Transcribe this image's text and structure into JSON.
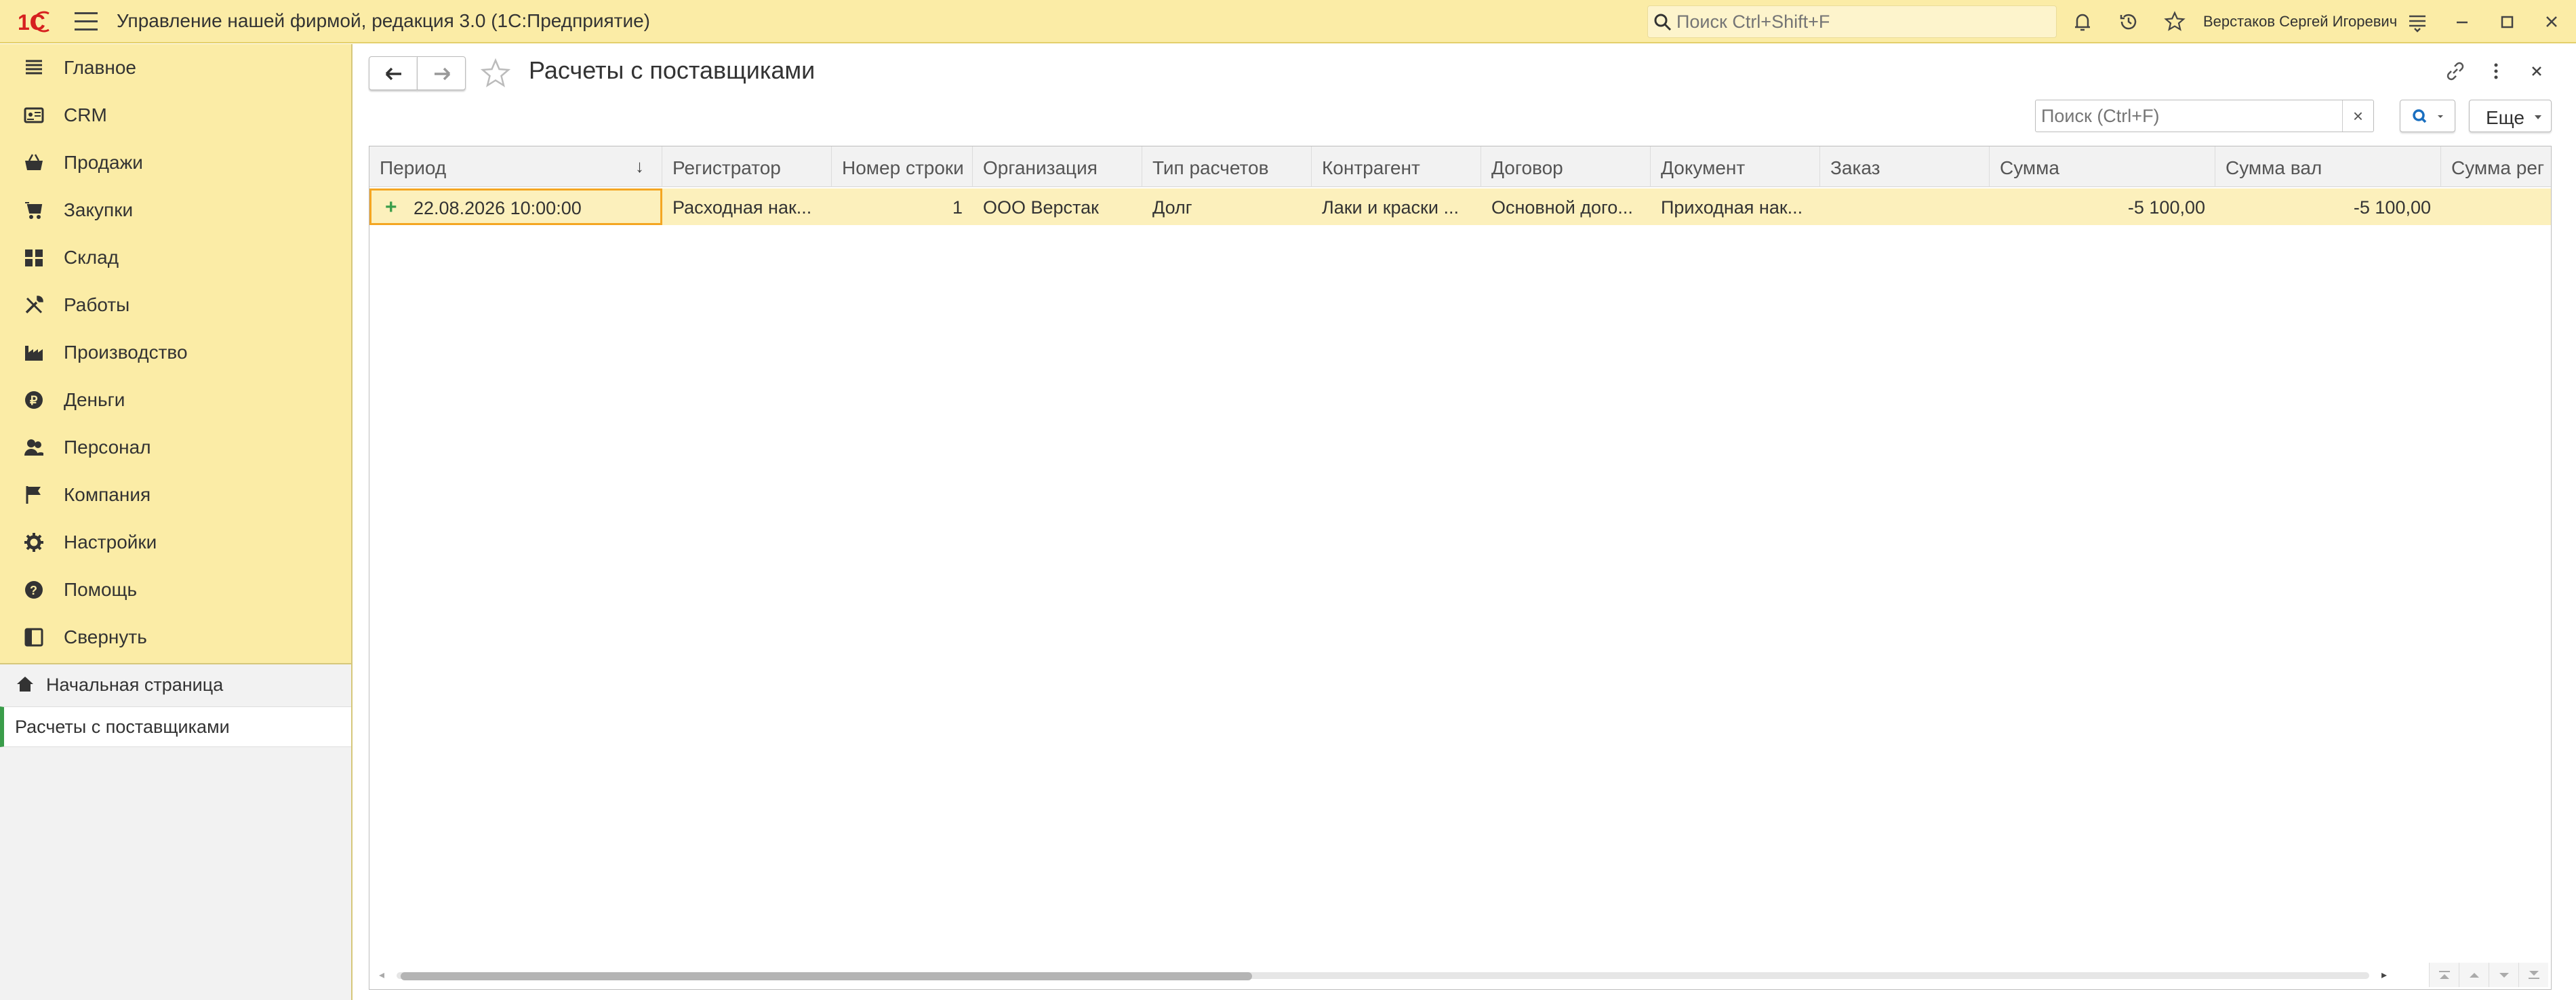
{
  "app": {
    "title": "Управление нашей фирмой, редакция 3.0  (1С:Предприятие)",
    "search_placeholder": "Поиск Ctrl+Shift+F",
    "user_name": "Верстаков Сергей Игоревич",
    "logo_text": "1С",
    "accent_color": "#fbeca6"
  },
  "sidebar": {
    "items": [
      {
        "label": "Главное",
        "icon": "menu-list-icon"
      },
      {
        "label": "CRM",
        "icon": "contact-card-icon"
      },
      {
        "label": "Продажи",
        "icon": "basket-icon"
      },
      {
        "label": "Закупки",
        "icon": "purchase-icon"
      },
      {
        "label": "Склад",
        "icon": "warehouse-icon"
      },
      {
        "label": "Работы",
        "icon": "tools-icon"
      },
      {
        "label": "Производство",
        "icon": "factory-icon"
      },
      {
        "label": "Деньги",
        "icon": "money-icon"
      },
      {
        "label": "Персонал",
        "icon": "people-icon"
      },
      {
        "label": "Компания",
        "icon": "flag-icon"
      },
      {
        "label": "Настройки",
        "icon": "gear-icon"
      },
      {
        "label": "Помощь",
        "icon": "help-icon"
      },
      {
        "label": "Свернуть",
        "icon": "collapse-panel-icon"
      }
    ],
    "open_windows": {
      "home": "Начальная страница",
      "current": "Расчеты с поставщиками"
    }
  },
  "form": {
    "title": "Расчеты с поставщиками",
    "list_search_placeholder": "Поиск (Ctrl+F)",
    "clear_label": "×",
    "more_label": "Еще"
  },
  "table": {
    "columns": [
      "Период",
      "Регистратор",
      "Номер строки",
      "Организация",
      "Тип расчетов",
      "Контрагент",
      "Договор",
      "Документ",
      "Заказ",
      "Сумма",
      "Сумма вал",
      "Сумма рег"
    ],
    "rows": [
      {
        "period": "22.08.2026 10:00:00",
        "registrator": "Расходная нак...",
        "line_number": "1",
        "organization": "ООО Верстак",
        "settlement_type": "Долг",
        "counterparty": "Лаки и краски ...",
        "contract": "Основной дого...",
        "document": "Приходная нак...",
        "order": "",
        "amount": "-5 100,00",
        "amount_cur": "-5 100,00",
        "amount_reg": ""
      }
    ]
  }
}
